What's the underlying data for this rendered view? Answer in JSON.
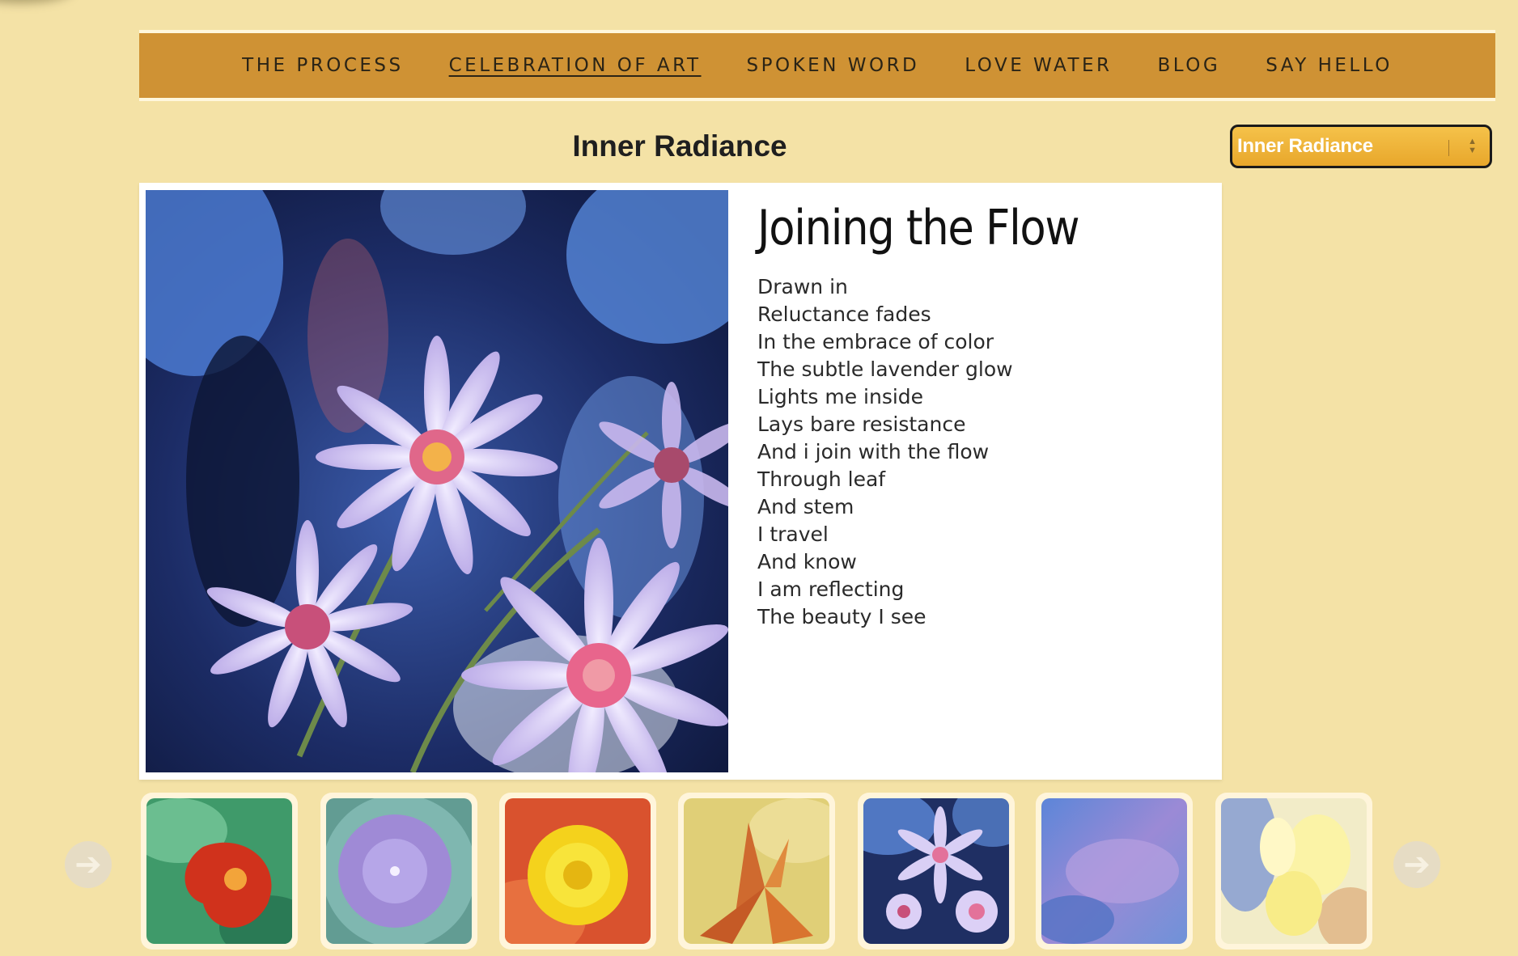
{
  "nav": {
    "items": [
      {
        "label": "THE PROCESS"
      },
      {
        "label": "CELEBRATION OF ART",
        "active": true
      },
      {
        "label": "SPOKEN WORD"
      },
      {
        "label": "LOVE WATER"
      },
      {
        "label": "BLOG"
      },
      {
        "label": "SAY HELLO"
      }
    ]
  },
  "gallery": {
    "title": "Inner Radiance",
    "selector_value": "Inner Radiance"
  },
  "poem": {
    "title": "Joining the Flow",
    "lines": [
      "Drawn in",
      "Reluctance fades",
      "In the embrace of color",
      "The subtle lavender glow",
      "Lights me inside",
      "Lays bare resistance",
      "And i join with the flow",
      "Through leaf",
      "And stem",
      "I travel",
      "And know",
      "I am reflecting",
      "The beauty I see"
    ]
  },
  "thumbnails": {
    "prev_icon": "arrow-left-icon",
    "next_icon": "arrow-right-icon",
    "items": [
      {
        "subject": "red nasturtium"
      },
      {
        "subject": "purple morning glory"
      },
      {
        "subject": "yellow dandelion"
      },
      {
        "subject": "orange lily"
      },
      {
        "subject": "lavender asters"
      },
      {
        "subject": "blue-purple abstract"
      },
      {
        "subject": "pale yellow flower"
      }
    ]
  },
  "colors": {
    "page_background": "#f4e2a6",
    "nav_background": "#cf9234",
    "selector_background": "#eeb43a"
  }
}
